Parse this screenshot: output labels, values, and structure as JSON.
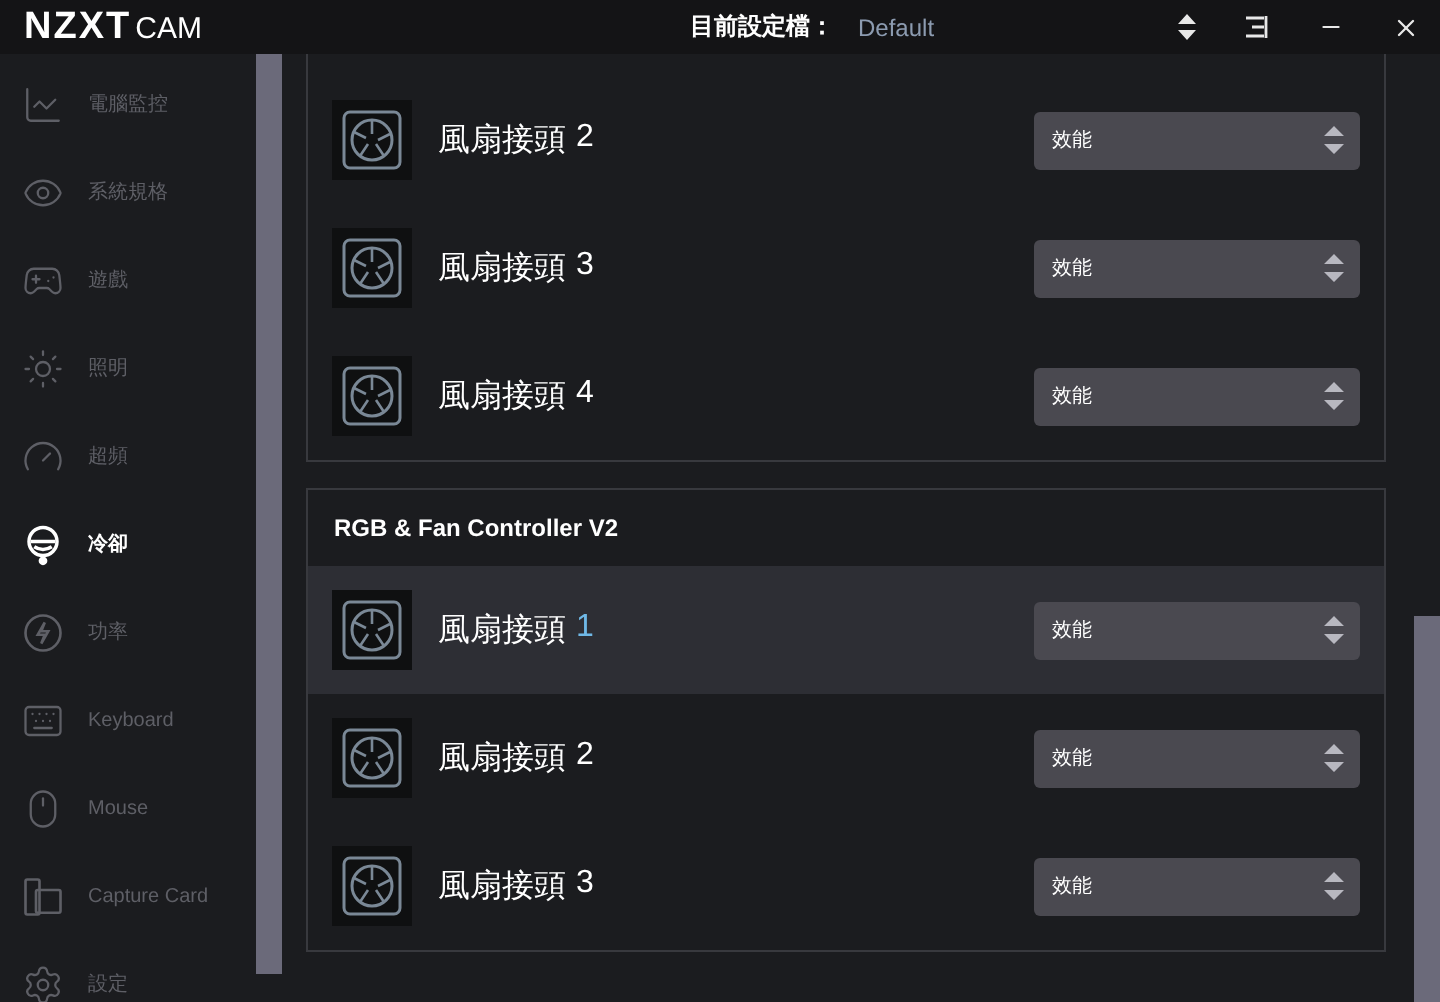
{
  "title_bar": {
    "logo_primary": "NZXT",
    "logo_secondary": "CAM",
    "profile_label": "目前設定檔：",
    "profile_value": "Default"
  },
  "sidebar": {
    "items": [
      {
        "label": "電腦監控",
        "selected": false
      },
      {
        "label": "系統規格",
        "selected": false
      },
      {
        "label": "遊戲",
        "selected": false
      },
      {
        "label": "照明",
        "selected": false
      },
      {
        "label": "超頻",
        "selected": false
      },
      {
        "label": "冷卻",
        "selected": true
      },
      {
        "label": "功率",
        "selected": false
      },
      {
        "label": "Keyboard",
        "selected": false
      },
      {
        "label": "Mouse",
        "selected": false
      },
      {
        "label": "Capture Card",
        "selected": false
      },
      {
        "label": "設定",
        "selected": false
      }
    ]
  },
  "devices": [
    {
      "fans": [
        {
          "label": "風扇接頭",
          "port": "2",
          "mode": "效能",
          "selected": false
        },
        {
          "label": "風扇接頭",
          "port": "3",
          "mode": "效能",
          "selected": false
        },
        {
          "label": "風扇接頭",
          "port": "4",
          "mode": "效能",
          "selected": false
        }
      ]
    },
    {
      "name": "RGB & Fan Controller V2",
      "fans": [
        {
          "label": "風扇接頭",
          "port": "1",
          "mode": "效能",
          "selected": true
        },
        {
          "label": "風扇接頭",
          "port": "2",
          "mode": "效能",
          "selected": false
        },
        {
          "label": "風扇接頭",
          "port": "3",
          "mode": "效能",
          "selected": false
        }
      ]
    }
  ]
}
